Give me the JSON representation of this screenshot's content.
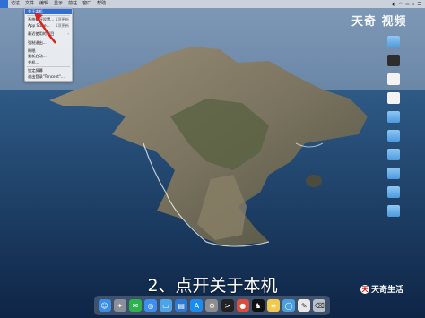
{
  "menubar": {
    "apple_symbol": "",
    "items": [
      "访达",
      "文件",
      "编辑",
      "显示",
      "前往",
      "窗口",
      "帮助"
    ],
    "status_items": [
      "",
      "",
      "",
      "",
      ""
    ]
  },
  "apple_menu": {
    "items": [
      {
        "label": "关于本机",
        "shortcut": "",
        "selected": true
      },
      {
        "label": "系统偏好设置...",
        "shortcut": "1项更新",
        "selected": false
      },
      {
        "label": "App Store...",
        "shortcut": "1项更新",
        "selected": false
      },
      {
        "label": "最近使用的项目",
        "shortcut": "",
        "selected": false
      },
      {
        "label": "强制退出...",
        "shortcut": "",
        "selected": false
      },
      {
        "label": "睡眠",
        "shortcut": "",
        "selected": false
      },
      {
        "label": "重新启动...",
        "shortcut": "",
        "selected": false
      },
      {
        "label": "关机...",
        "shortcut": "",
        "selected": false
      },
      {
        "label": "锁定屏幕",
        "shortcut": "",
        "selected": false
      },
      {
        "label": "退出登录\"Tencent\"...",
        "shortcut": "",
        "selected": false
      }
    ]
  },
  "watermark_top": "天奇 视频",
  "desktop_icons": [
    {
      "label": "",
      "kind": "folder"
    },
    {
      "label": "",
      "kind": "dark"
    },
    {
      "label": "",
      "kind": "doc"
    },
    {
      "label": "",
      "kind": "doc"
    },
    {
      "label": "",
      "kind": "folder"
    },
    {
      "label": "",
      "kind": "folder"
    },
    {
      "label": "",
      "kind": "folder"
    },
    {
      "label": "",
      "kind": "folder"
    },
    {
      "label": "",
      "kind": "folder"
    },
    {
      "label": "",
      "kind": "folder"
    },
    {
      "label": "",
      "kind": "folder"
    }
  ],
  "caption": "2、点开关于本机",
  "dock_apps": [
    {
      "name": "finder",
      "color": "#3a8ee6",
      "glyph": "☺"
    },
    {
      "name": "launchpad",
      "color": "#8a8f99",
      "glyph": "✦"
    },
    {
      "name": "wechat",
      "color": "#2bb24c",
      "glyph": "✉"
    },
    {
      "name": "safari",
      "color": "#3d8ef0",
      "glyph": "◎"
    },
    {
      "name": "folder",
      "color": "#4ea2e6",
      "glyph": "▭"
    },
    {
      "name": "files",
      "color": "#2f78d4",
      "glyph": "▤"
    },
    {
      "name": "appstore",
      "color": "#1a8cf0",
      "glyph": "A"
    },
    {
      "name": "settings",
      "color": "#8d8d8d",
      "glyph": "⚙"
    },
    {
      "name": "terminal",
      "color": "#222222",
      "glyph": ">"
    },
    {
      "name": "chrome",
      "color": "#dd4b39",
      "glyph": "●"
    },
    {
      "name": "qq",
      "color": "#111111",
      "glyph": "♞"
    },
    {
      "name": "notes",
      "color": "#f2c94c",
      "glyph": "≡"
    },
    {
      "name": "quicktime",
      "color": "#4a9fe0",
      "glyph": "◯"
    },
    {
      "name": "textedit",
      "color": "#e8e8e8",
      "glyph": "✎"
    },
    {
      "name": "trash",
      "color": "#b9c0c9",
      "glyph": "🗑"
    }
  ],
  "watermark_bottom": "天奇生活",
  "watermark_bottom_badge": "天"
}
